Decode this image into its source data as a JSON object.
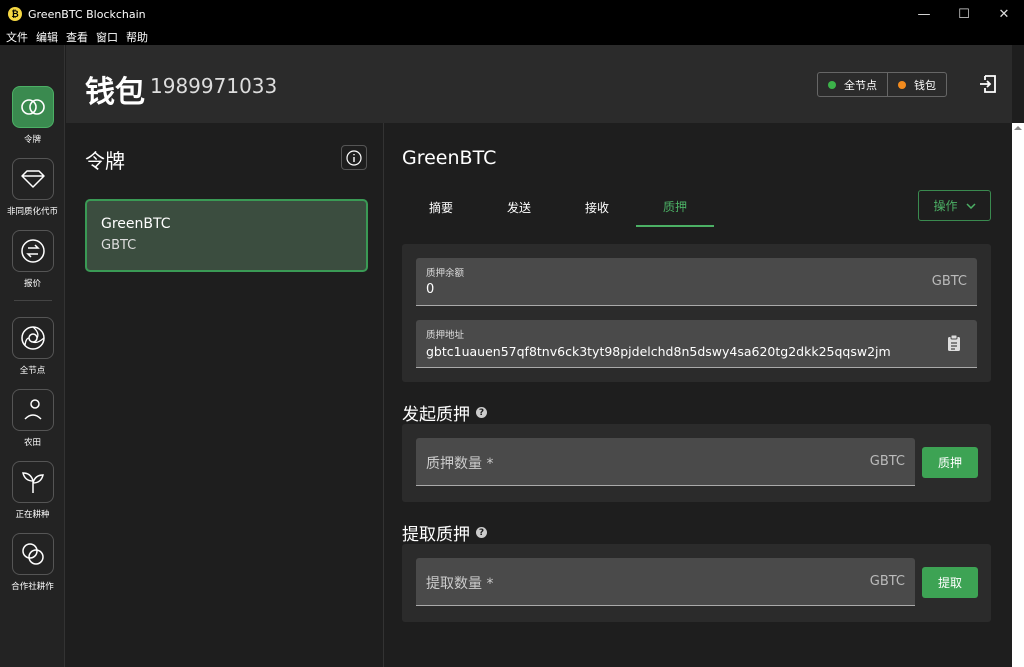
{
  "window": {
    "title": "GreenBTC Blockchain",
    "controls": {
      "minimize": "—",
      "maximize": "☐",
      "close": "✕"
    }
  },
  "menu": [
    "文件",
    "编辑",
    "查看",
    "窗口",
    "帮助"
  ],
  "sidebar": {
    "items": [
      {
        "label": "令牌",
        "icon": "tokens-icon",
        "active": true
      },
      {
        "label": "非同质化代币",
        "icon": "diamond-icon"
      },
      {
        "label": "报价",
        "icon": "exchange-icon"
      },
      {
        "label": "全节点",
        "icon": "full-node-icon"
      },
      {
        "label": "农田",
        "icon": "farm-icon"
      },
      {
        "label": "正在耕种",
        "icon": "sprout-icon"
      },
      {
        "label": "合作社耕作",
        "icon": "pool-icon"
      }
    ]
  },
  "header": {
    "title": "钱包",
    "fingerprint": "1989971033",
    "status": [
      {
        "label": "全节点",
        "color": "#3cb34a"
      },
      {
        "label": "钱包",
        "color": "#f28b1e"
      }
    ]
  },
  "left_panel": {
    "title": "令牌",
    "token": {
      "name": "GreenBTC",
      "symbol": "GBTC"
    }
  },
  "main": {
    "coin_title": "GreenBTC",
    "tabs": [
      "摘要",
      "发送",
      "接收",
      "质押"
    ],
    "active_tab": "质押",
    "actions_label": "操作",
    "stake_balance": {
      "label": "质押余额",
      "value": "0",
      "unit": "GBTC"
    },
    "stake_address": {
      "label": "质押地址",
      "value": "gbtc1uauen57qf8tnv6ck3tyt98pjdelchd8n5dswy4sa620tg2dkk25qqsw2jm"
    },
    "stake_section": {
      "title": "发起质押",
      "placeholder": "质押数量 *",
      "unit": "GBTC",
      "button": "质押"
    },
    "withdraw_section": {
      "title": "提取质押",
      "placeholder": "提取数量 *",
      "unit": "GBTC",
      "button": "提取"
    }
  },
  "colors": {
    "accent": "#3da354",
    "accent_border": "#4cb065",
    "bg": "#1e1e1e",
    "panel": "#2b2b2b"
  }
}
